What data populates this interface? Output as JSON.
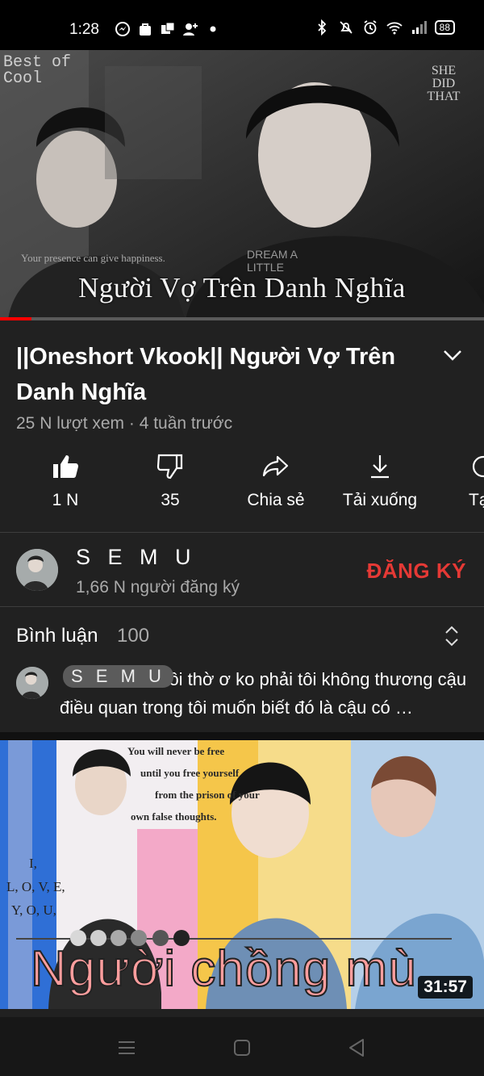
{
  "status_bar": {
    "time": "1:28",
    "battery": "88",
    "left_icons": [
      "messenger-icon",
      "shop-icon",
      "gallery-icon",
      "add-person-icon",
      "dot-icon"
    ],
    "right_icons": [
      "bluetooth-icon",
      "mute-icon",
      "alarm-icon",
      "wifi-icon",
      "signal-icon",
      "battery-icon"
    ]
  },
  "player": {
    "overlay_title": "Người Vợ Trên Danh Nghĩa",
    "deco_text_left": "Best of",
    "deco_text_cool": "Cool",
    "deco_text_right": "SHE DID THAT",
    "deco_presence": "Your presence can give happiness.",
    "deco_dream": "DREAM A LITTLE",
    "progress_fraction": 0.065
  },
  "video": {
    "title": "||Oneshort Vkook|| Người Vợ Trên Danh Nghĩa",
    "meta": "25 N lượt xem · 4 tuần trước"
  },
  "actions": [
    {
      "name": "like",
      "label": "1 N",
      "icon": "thumbs-up-icon"
    },
    {
      "name": "dislike",
      "label": "35",
      "icon": "thumbs-down-icon"
    },
    {
      "name": "share",
      "label": "Chia sẻ",
      "icon": "share-icon"
    },
    {
      "name": "download",
      "label": "Tải xuống",
      "icon": "download-icon"
    },
    {
      "name": "save",
      "label": "Tạ",
      "icon": "save-icon"
    }
  ],
  "channel": {
    "name": "S E M U",
    "subscribers": "1,66 N người đăng ký",
    "subscribe_label": "ĐĂNG KÝ"
  },
  "comments": {
    "heading": "Bình luận",
    "count": "100",
    "top_comment": {
      "author": "S E M U",
      "text": "Tôi thờ ơ ko phải tôi không thương cậu điều quan trong tôi muốn biết đó là cậu có …"
    }
  },
  "next_video": {
    "overlay_title": "Người chồng mù",
    "duration": "31:57",
    "quote_lines": [
      "You will never be free",
      "until you free yourself",
      "from the prison of your",
      "own false thoughts."
    ],
    "letters": [
      "I,",
      "L, O, V, E,",
      "Y, O, U,"
    ]
  },
  "colors": {
    "background": "#212121",
    "accent_red": "#e53935",
    "progress": "#ff0000",
    "secondary_text": "#aaaaaa"
  }
}
